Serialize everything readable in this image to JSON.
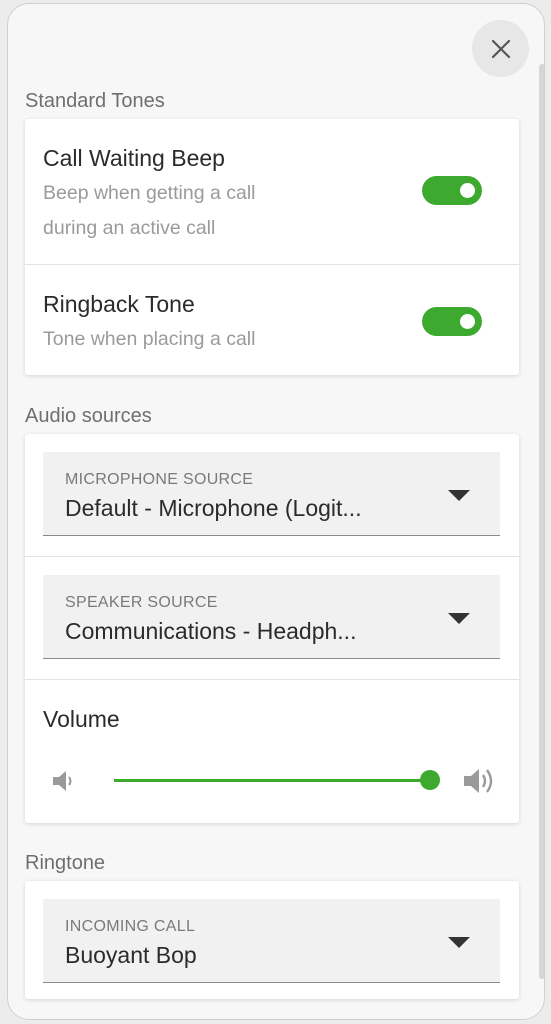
{
  "colors": {
    "accent": "#3daa2f",
    "panel_background": "#f7f7f7",
    "card_background": "#ffffff"
  },
  "header": {
    "close_icon": "close-icon"
  },
  "standard_tones": {
    "title": "Standard Tones",
    "items": [
      {
        "title": "Call Waiting Beep",
        "description_lines": [
          "Beep when getting a call",
          "during an active call"
        ],
        "enabled": true
      },
      {
        "title": "Ringback Tone",
        "description_lines": [
          "Tone when placing a call"
        ],
        "enabled": true
      }
    ]
  },
  "audio_sources": {
    "title": "Audio sources",
    "microphone": {
      "label": "MICROPHONE SOURCE",
      "value": "Default - Microphone (Logit..."
    },
    "speaker": {
      "label": "SPEAKER SOURCE",
      "value": "Communications - Headph..."
    },
    "volume": {
      "label": "Volume",
      "level": 1.0,
      "min_icon": "volume-low-icon",
      "max_icon": "volume-high-icon"
    }
  },
  "ringtone": {
    "title": "Ringtone",
    "incoming_call": {
      "label": "INCOMING CALL",
      "value": "Buoyant Bop"
    }
  }
}
